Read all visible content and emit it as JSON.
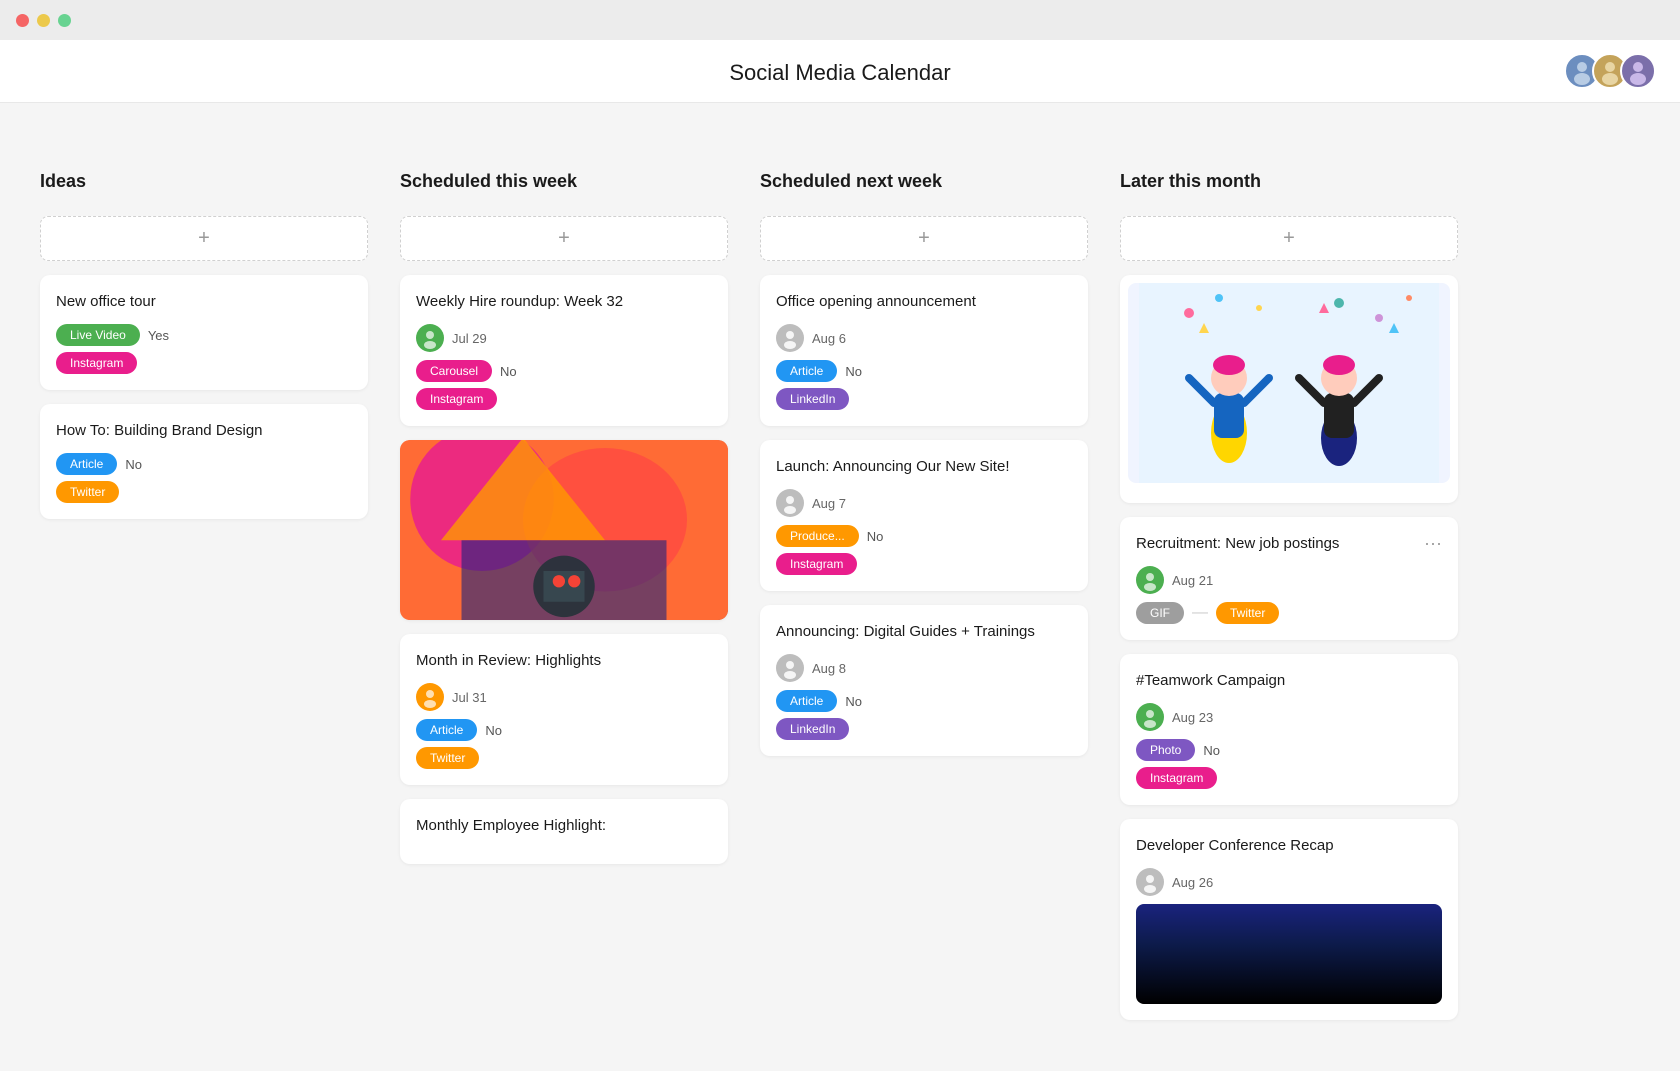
{
  "app": {
    "title": "Social Media Calendar"
  },
  "titlebar": {
    "dots": [
      "dot1",
      "dot2",
      "dot3"
    ]
  },
  "avatars": [
    {
      "id": "a1",
      "color": "#6c8ebf",
      "label": "U1"
    },
    {
      "id": "a2",
      "color": "#c4a35a",
      "label": "U2"
    },
    {
      "id": "a3",
      "color": "#7b6faa",
      "label": "U3"
    }
  ],
  "columns": [
    {
      "id": "ideas",
      "title": "Ideas",
      "add_label": "+",
      "cards": [
        {
          "id": "card1",
          "title": "New office tour",
          "tags": [
            {
              "label": "Live Video",
              "color": "green"
            },
            {
              "label": "Yes",
              "type": "value"
            },
            {
              "label": "Instagram",
              "color": "pink"
            }
          ]
        },
        {
          "id": "card2",
          "title": "How To: Building Brand Design",
          "tags": [
            {
              "label": "Article",
              "color": "blue"
            },
            {
              "label": "No",
              "type": "value"
            },
            {
              "label": "Twitter",
              "color": "orange"
            }
          ]
        }
      ]
    },
    {
      "id": "scheduled-this-week",
      "title": "Scheduled this week",
      "add_label": "+",
      "cards": [
        {
          "id": "card3",
          "title": "Weekly Hire roundup: Week 32",
          "avatar_color": "#4caf50",
          "date": "Jul 29",
          "tags": [
            {
              "label": "Carousel",
              "color": "pink"
            },
            {
              "label": "No",
              "type": "value"
            },
            {
              "label": "Instagram",
              "color": "pink"
            }
          ]
        },
        {
          "id": "card4",
          "title": "",
          "has_image": true,
          "image_type": "abstract"
        },
        {
          "id": "card5",
          "title": "Month in Review: Highlights",
          "avatar_color": "#ff9800",
          "date": "Jul 31",
          "tags": [
            {
              "label": "Article",
              "color": "blue"
            },
            {
              "label": "No",
              "type": "value"
            },
            {
              "label": "Twitter",
              "color": "orange"
            }
          ]
        },
        {
          "id": "card6",
          "title": "Monthly Employee Highlight:",
          "partial": true
        }
      ]
    },
    {
      "id": "scheduled-next-week",
      "title": "Scheduled next week",
      "add_label": "+",
      "cards": [
        {
          "id": "card7",
          "title": "Office opening announcement",
          "avatar_color": "#9e9e9e",
          "date": "Aug 6",
          "tags": [
            {
              "label": "Article",
              "color": "blue"
            },
            {
              "label": "No",
              "type": "value"
            },
            {
              "label": "LinkedIn",
              "color": "purple"
            }
          ]
        },
        {
          "id": "card8",
          "title": "Launch: Announcing Our New Site!",
          "avatar_color": "#9e9e9e",
          "date": "Aug 7",
          "tags": [
            {
              "label": "Produce...",
              "color": "produce"
            },
            {
              "label": "No",
              "type": "value"
            },
            {
              "label": "Instagram",
              "color": "pink"
            }
          ]
        },
        {
          "id": "card9",
          "title": "Announcing: Digital Guides + Trainings",
          "avatar_color": "#9e9e9e",
          "date": "Aug 8",
          "tags": [
            {
              "label": "Article",
              "color": "blue"
            },
            {
              "label": "No",
              "type": "value"
            },
            {
              "label": "LinkedIn",
              "color": "purple"
            }
          ]
        }
      ]
    },
    {
      "id": "later-this-month",
      "title": "Later this month",
      "add_label": "+",
      "cards": [
        {
          "id": "card10",
          "title": "",
          "has_image": true,
          "image_type": "celebration"
        },
        {
          "id": "card11",
          "title": "Recruitment: New job postings",
          "avatar_color": "#4caf50",
          "date": "Aug 21",
          "tags": [
            {
              "label": "GIF",
              "color": "gray"
            },
            {
              "label": "Twitter",
              "color": "orange"
            }
          ],
          "has_menu": true
        },
        {
          "id": "card12",
          "title": "#Teamwork Campaign",
          "avatar_color": "#4caf50",
          "date": "Aug 23",
          "tags": [
            {
              "label": "Photo",
              "color": "purple"
            },
            {
              "label": "No",
              "type": "value"
            },
            {
              "label": "Instagram",
              "color": "pink"
            }
          ]
        },
        {
          "id": "card13",
          "title": "Developer Conference Recap",
          "avatar_color": "#9e9e9e",
          "date": "Aug 26",
          "has_dark_image": true,
          "partial": true
        }
      ]
    }
  ]
}
